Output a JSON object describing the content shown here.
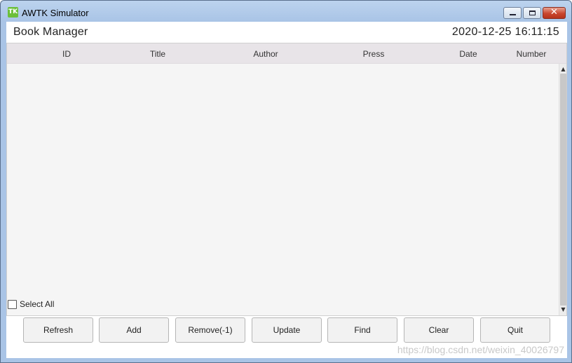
{
  "window": {
    "title": "AWTK Simulator",
    "logo_text": "TK",
    "controls": {
      "minimize": "minimize",
      "maximize": "maximize",
      "close": "✕"
    }
  },
  "header": {
    "title": "Book Manager",
    "datetime": "2020-12-25 16:11:15"
  },
  "table": {
    "columns": [
      "ID",
      "Title",
      "Author",
      "Press",
      "Date",
      "Number"
    ],
    "rows": []
  },
  "scrollbar": {
    "up": "▲",
    "down": "▼"
  },
  "select_all": {
    "label": "Select All",
    "checked": false
  },
  "buttons": {
    "refresh": "Refresh",
    "add": "Add",
    "remove": "Remove(-1)",
    "update": "Update",
    "find": "Find",
    "clear": "Clear",
    "quit": "Quit"
  },
  "watermark": "https://blog.csdn.net/weixin_40026797",
  "colors": {
    "titlebar": "#a9c4e6",
    "table_header": "#e8e4e8",
    "table_body": "#f5f5f5",
    "close_button": "#c9462f"
  }
}
